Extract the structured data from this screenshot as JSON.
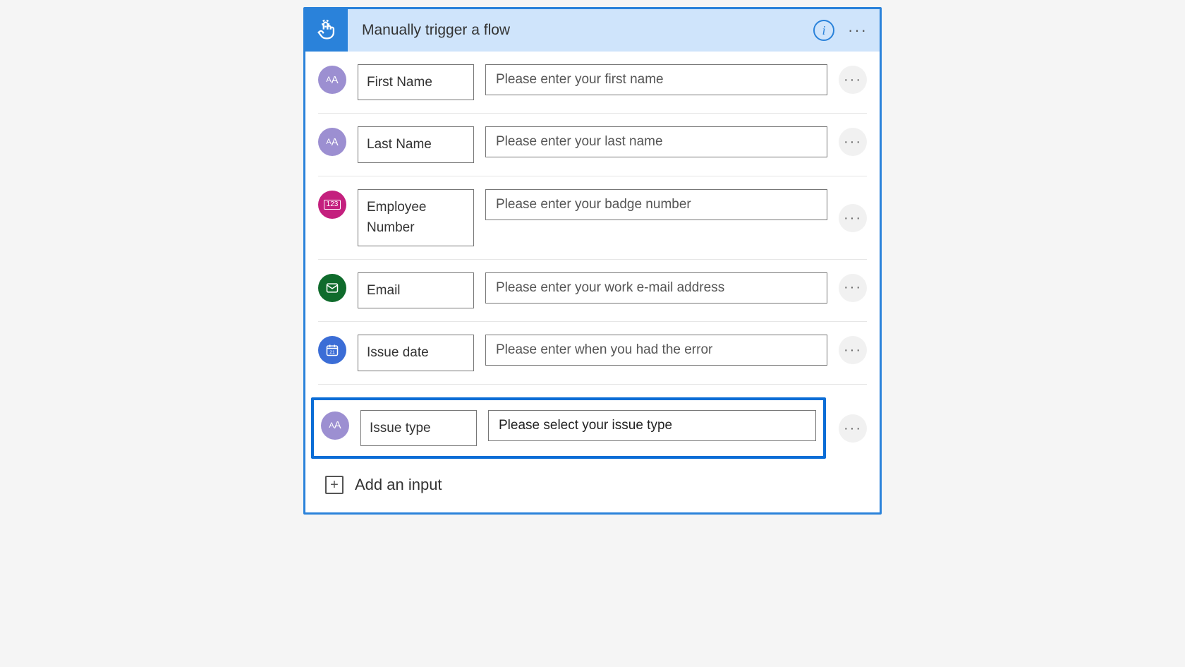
{
  "header": {
    "title": "Manually trigger a flow"
  },
  "inputs": [
    {
      "icon": "text",
      "name": "First Name",
      "placeholder": "Please enter your first name"
    },
    {
      "icon": "text",
      "name": "Last Name",
      "placeholder": "Please enter your last name"
    },
    {
      "icon": "number",
      "name": "Employee Number",
      "placeholder": "Please enter your badge number"
    },
    {
      "icon": "email",
      "name": "Email",
      "placeholder": "Please enter your work e-mail address"
    },
    {
      "icon": "date",
      "name": "Issue date",
      "placeholder": "Please enter when you had the error"
    },
    {
      "icon": "text",
      "name": "Issue type",
      "placeholder": "Please select your issue type",
      "highlighted": true,
      "active": true
    }
  ],
  "addInput": {
    "label": "Add an input"
  }
}
